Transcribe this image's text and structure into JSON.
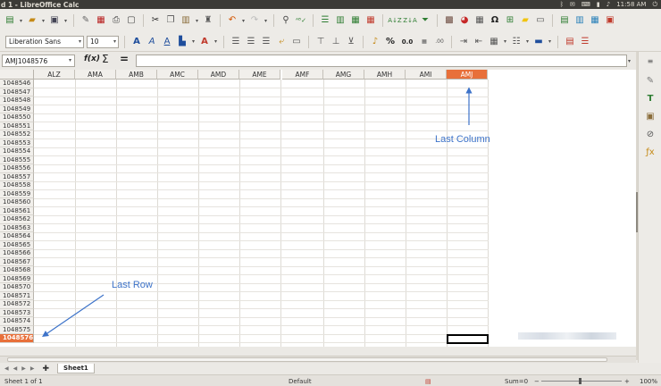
{
  "window": {
    "title": "d 1 - LibreOffice Calc",
    "time": "11:58 AM"
  },
  "toolbar": {
    "font_name": "Liberation Sans",
    "font_size": "10",
    "icons_row1": [
      "new-icon",
      "open-icon",
      "save-icon",
      "email-icon",
      "edit-file-icon",
      "pdf-icon",
      "print-icon",
      "print-preview-icon",
      "cut-icon",
      "copy-icon",
      "paste-icon",
      "clone-formatting-icon",
      "undo-icon",
      "redo-icon",
      "find-icon",
      "spellcheck-icon",
      "row-icon",
      "column-icon",
      "insert-rows-icon",
      "delete-rows-icon",
      "sort-asc-icon",
      "sort-desc-icon",
      "autofilter-icon",
      "image-icon",
      "chart-icon",
      "pivot-icon",
      "special-char-icon",
      "hyperlink-icon",
      "comment-icon",
      "header-footer-icon",
      "define-print-area-icon",
      "freeze-icon",
      "split-icon",
      "show-draw-icon"
    ],
    "number_percent": "%",
    "number_decimal": "0.0"
  },
  "formula_bar": {
    "name_box": "AMJ1048576",
    "fx": "f(x)",
    "sum": "Σ",
    "equals": "="
  },
  "columns": [
    "ALZ",
    "AMA",
    "AMB",
    "AMC",
    "AMD",
    "AME",
    "AMF",
    "AMG",
    "AMH",
    "AMI",
    "AMJ"
  ],
  "selected_column": "AMJ",
  "rows": [
    "1048546",
    "1048547",
    "1048548",
    "1048549",
    "1048550",
    "1048551",
    "1048552",
    "1048553",
    "1048554",
    "1048555",
    "1048556",
    "1048557",
    "1048558",
    "1048559",
    "1048560",
    "1048561",
    "1048562",
    "1048563",
    "1048564",
    "1048565",
    "1048566",
    "1048567",
    "1048568",
    "1048569",
    "1048570",
    "1048571",
    "1048572",
    "1048573",
    "1048574",
    "1048575",
    "1048576"
  ],
  "selected_row": "1048576",
  "annotations": {
    "last_column": "Last Column",
    "last_row": "Last Row"
  },
  "sheet_tab": "Sheet1",
  "status": {
    "sheet": "Sheet 1 of 1",
    "style": "Default",
    "sum": "Sum=0",
    "zoom": "100%"
  }
}
